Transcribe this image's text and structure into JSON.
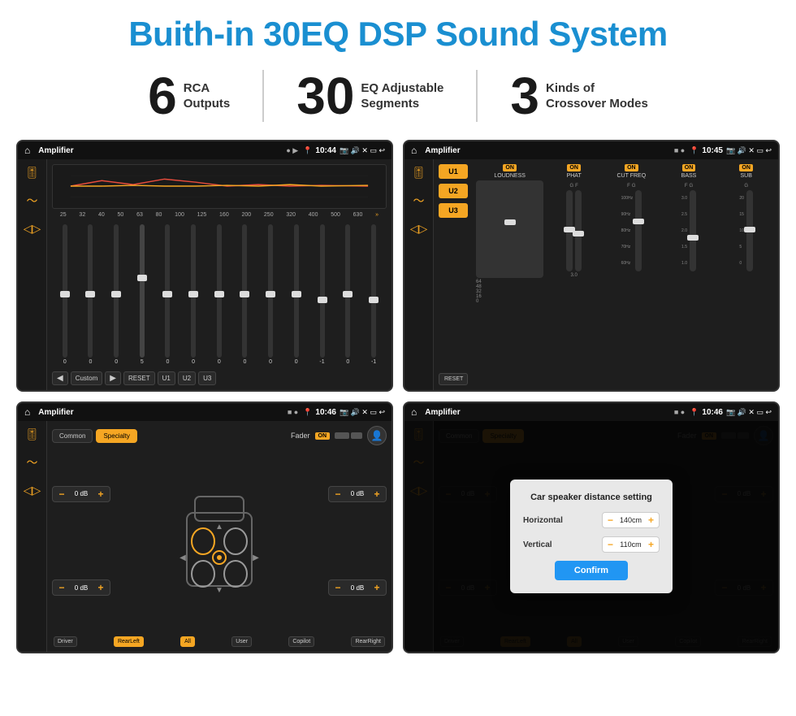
{
  "header": {
    "title": "Buith-in 30EQ DSP Sound System"
  },
  "features": [
    {
      "num": "6",
      "line1": "RCA",
      "line2": "Outputs"
    },
    {
      "num": "30",
      "line1": "EQ Adjustable",
      "line2": "Segments"
    },
    {
      "num": "3",
      "line1": "Kinds of",
      "line2": "Crossover Modes"
    }
  ],
  "screens": [
    {
      "id": "eq-screen",
      "status": {
        "title": "Amplifier",
        "time": "10:44"
      },
      "freq_labels": [
        "25",
        "32",
        "40",
        "50",
        "63",
        "80",
        "100",
        "125",
        "160",
        "200",
        "250",
        "320",
        "400",
        "500",
        "630"
      ],
      "slider_values": [
        "0",
        "0",
        "0",
        "5",
        "0",
        "0",
        "0",
        "0",
        "0",
        "0",
        "-1",
        "0",
        "-1"
      ],
      "bottom_btns": [
        "Custom",
        "RESET",
        "U1",
        "U2",
        "U3"
      ]
    },
    {
      "id": "crossover-screen",
      "status": {
        "title": "Amplifier",
        "time": "10:45"
      },
      "u_buttons": [
        "U1",
        "U2",
        "U3"
      ],
      "controls": [
        "LOUDNESS",
        "PHAT",
        "CUT FREQ",
        "BASS",
        "SUB"
      ],
      "reset_label": "RESET"
    },
    {
      "id": "fader-screen",
      "status": {
        "title": "Amplifier",
        "time": "10:46"
      },
      "tabs": [
        "Common",
        "Specialty"
      ],
      "fader_label": "Fader",
      "fader_on": "ON",
      "db_values": [
        "0 dB",
        "0 dB",
        "0 dB",
        "0 dB"
      ],
      "bottom_btns": [
        "Driver",
        "RearLeft",
        "All",
        "User",
        "Copilot",
        "RearRight"
      ]
    },
    {
      "id": "dialog-screen",
      "status": {
        "title": "Amplifier",
        "time": "10:46"
      },
      "tabs": [
        "Common",
        "Specialty"
      ],
      "dialog": {
        "title": "Car speaker distance setting",
        "horizontal_label": "Horizontal",
        "horizontal_val": "140cm",
        "vertical_label": "Vertical",
        "vertical_val": "110cm",
        "confirm_label": "Confirm"
      },
      "bottom_btns": [
        "Driver",
        "RearLeft",
        "All",
        "User",
        "Copilot",
        "RearRight"
      ]
    }
  ]
}
